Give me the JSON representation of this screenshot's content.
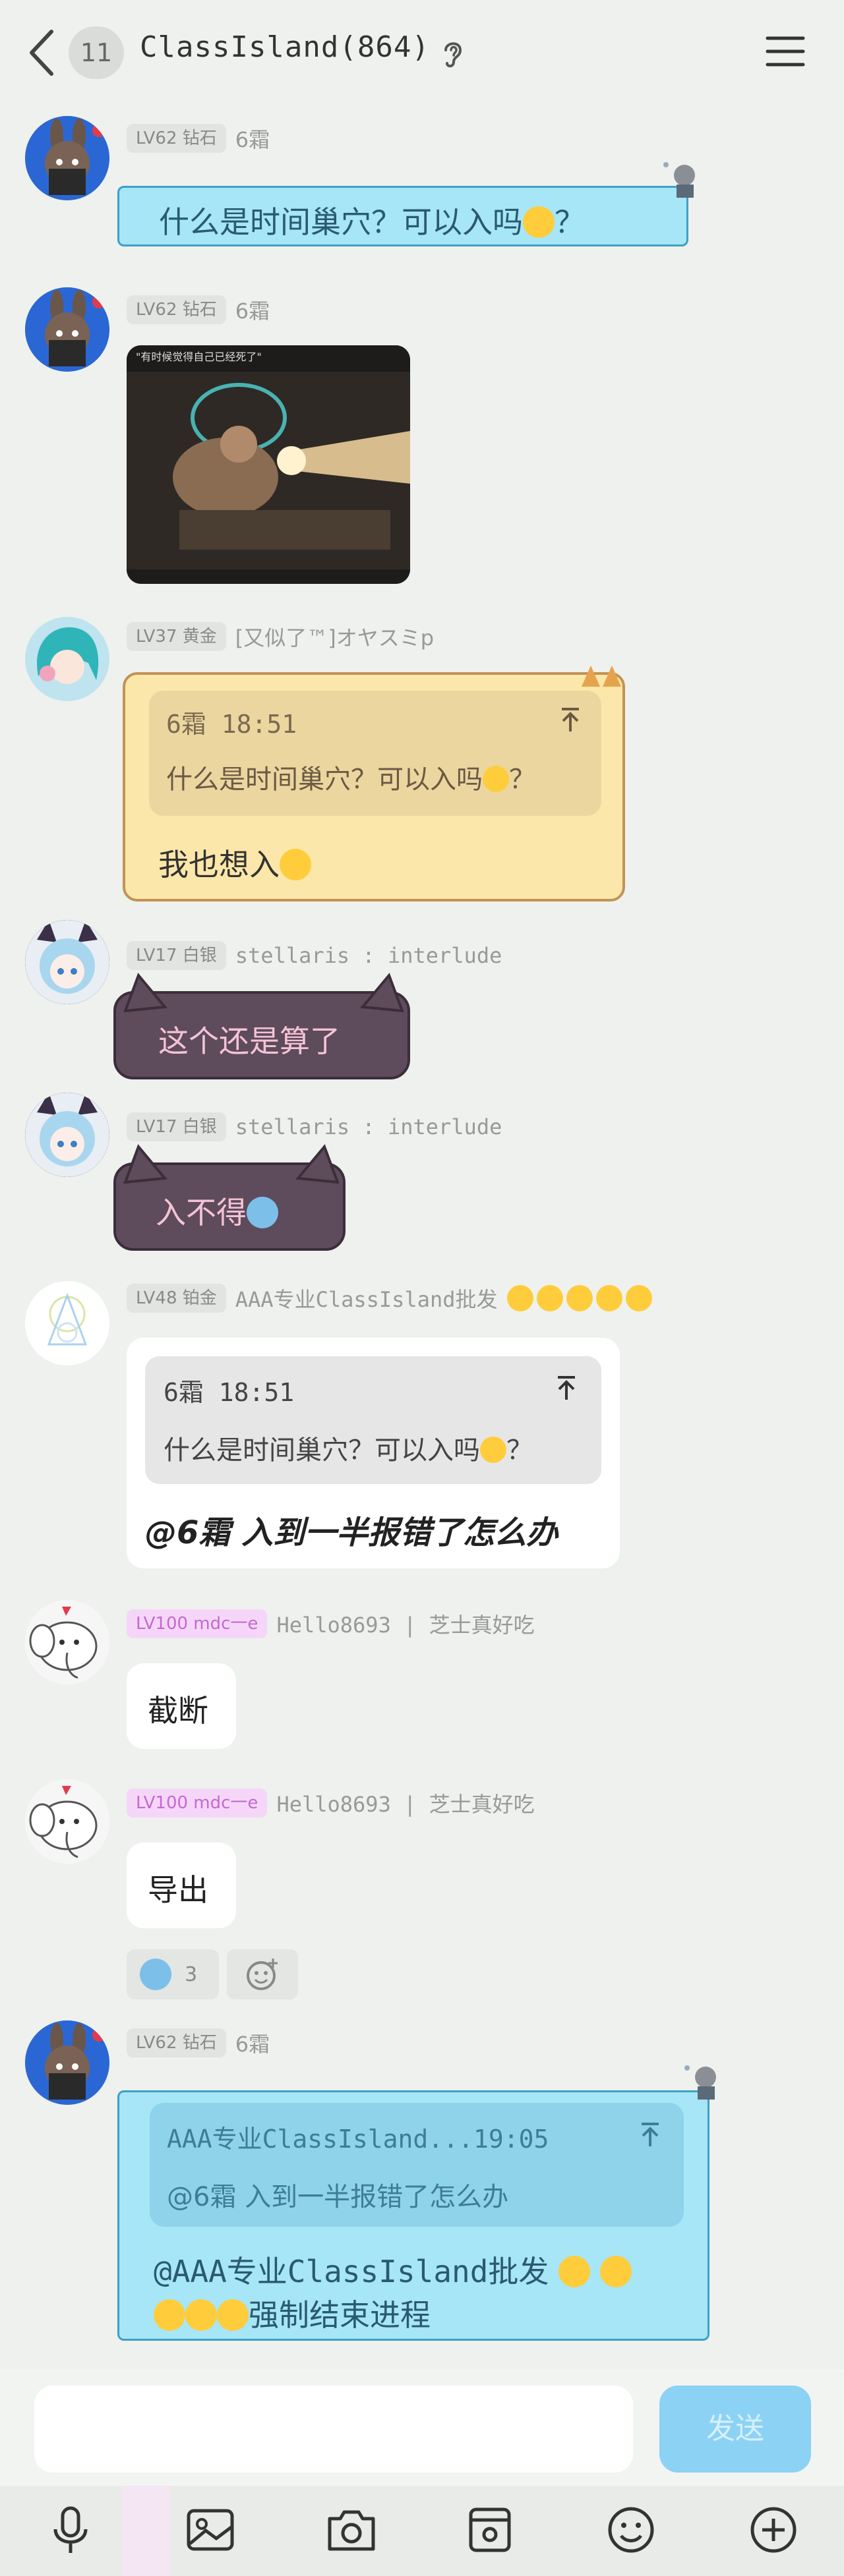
{
  "header": {
    "unread_count": "11",
    "title": "ClassIsland(864)"
  },
  "messages": [
    {
      "level": "LV62 钻石",
      "sender": "6霜",
      "text": "什么是时间巢穴？可以入吗",
      "text_tail": "？"
    },
    {
      "level": "LV62 钻石",
      "sender": "6霜",
      "image_caption": "\"有时候觉得自己已经死了\""
    },
    {
      "level": "LV37 黄金",
      "sender": "[又似了™]オヤスミp",
      "quote_author": "6霜",
      "quote_time": "18:51",
      "quote_text": "什么是时间巢穴？可以入吗",
      "quote_tail": "？",
      "text": "我也想入"
    },
    {
      "level": "LV17 白银",
      "sender": "stellaris : interlude",
      "text": "这个还是算了"
    },
    {
      "level": "LV17 白银",
      "sender": "stellaris : interlude",
      "text": "入不得"
    },
    {
      "level": "LV48 铂金",
      "sender": "AAA专业ClassIsland批发",
      "quote_author": "6霜",
      "quote_time": "18:51",
      "quote_text": "什么是时间巢穴？可以入吗",
      "quote_tail": "？",
      "text": "@6霜 入到一半报错了怎么办"
    },
    {
      "level": "LV100 mdc一e",
      "sender": "Hello8693 | 芝士真好吃",
      "text": "截断"
    },
    {
      "level": "LV100 mdc一e",
      "sender": "Hello8693 | 芝士真好吃",
      "text": "导出",
      "reaction_count": "3"
    },
    {
      "level": "LV62 钻石",
      "sender": "6霜",
      "quote_author": "AAA专业ClassIsland...",
      "quote_time": "19:05",
      "quote_text": "@6霜 入到一半报错了怎么办",
      "text_line1": "@AAA专业ClassIsland批发",
      "text_line2_tail": "强制结束进程"
    }
  ],
  "input": {
    "value": "",
    "send_label": "发送"
  },
  "toolbar_icons": [
    "mic-icon",
    "image-icon",
    "camera-icon",
    "sticker-icon",
    "emoji-icon",
    "plus-icon"
  ],
  "colors": {
    "background": "#eef1ee",
    "send_button": "#8cd2f4",
    "blue_bubble": "#a6e6f6",
    "yellow_bubble": "#fbe7a9"
  }
}
